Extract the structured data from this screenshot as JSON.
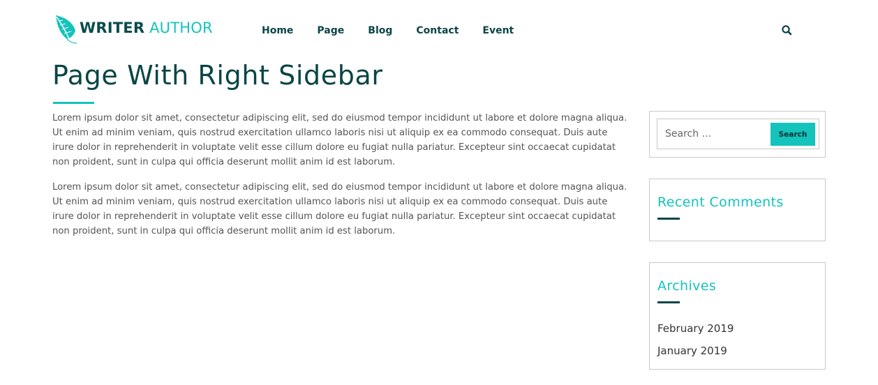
{
  "header": {
    "logo": {
      "icon": "feather-icon",
      "word1": "WRITER",
      "word2": "AUTHOR"
    },
    "nav": [
      "Home",
      "Page",
      "Blog",
      "Contact",
      "Event"
    ],
    "search_icon": "search-icon"
  },
  "main": {
    "title": "Page With Right Sidebar",
    "paragraphs": [
      "Lorem ipsum dolor sit amet, consectetur adipiscing elit, sed do eiusmod tempor incididunt ut labore et dolore magna aliqua. Ut enim ad minim veniam, quis nostrud exercitation ullamco laboris nisi ut aliquip ex ea commodo consequat. Duis aute irure dolor in reprehenderit in voluptate velit esse cillum dolore eu fugiat nulla pariatur. Excepteur sint occaecat cupidatat non proident, sunt in culpa qui officia deserunt mollit anim id est laborum.",
      "Lorem ipsum dolor sit amet, consectetur adipiscing elit, sed do eiusmod tempor incididunt ut labore et dolore magna aliqua. Ut enim ad minim veniam, quis nostrud exercitation ullamco laboris nisi ut aliquip ex ea commodo consequat. Duis aute irure dolor in reprehenderit in voluptate velit esse cillum dolore eu fugiat nulla pariatur. Excepteur sint occaecat cupidatat non proident, sunt in culpa qui officia deserunt mollit anim id est laborum."
    ]
  },
  "sidebar": {
    "search": {
      "placeholder": "Search …",
      "button_label": "Search"
    },
    "recent_comments": {
      "title": "Recent Comments"
    },
    "archives": {
      "title": "Archives",
      "items": [
        "February 2019",
        "January 2019"
      ]
    }
  },
  "colors": {
    "brand_dark": "#0b4546",
    "accent_teal": "#13c3bc",
    "body_text": "#555555",
    "border": "#c8c8c8"
  }
}
